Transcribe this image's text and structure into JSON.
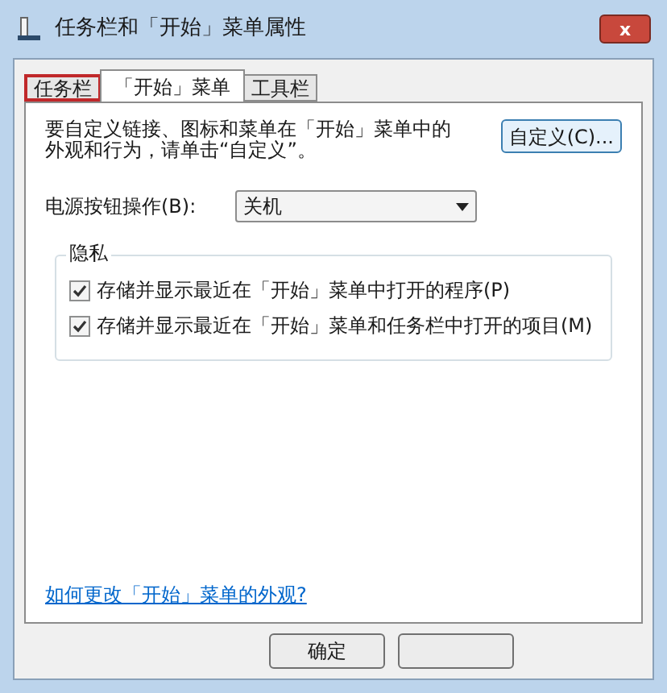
{
  "window": {
    "title": "任务栏和「开始」菜单属性",
    "close": "x"
  },
  "tabs": [
    {
      "label": "任务栏",
      "selected": false,
      "highlighted": true
    },
    {
      "label": "「开始」菜单",
      "selected": true,
      "highlighted": false
    },
    {
      "label": "工具栏",
      "selected": false,
      "highlighted": false
    }
  ],
  "description": "要自定义链接、图标和菜单在「开始」菜单中的外观和行为，请单击“自定义”。",
  "customize_button": "自定义(C)...",
  "power_button": {
    "label": "电源按钮操作(B):",
    "value": "关机"
  },
  "privacy": {
    "title": "隐私",
    "options": [
      {
        "label": "存储并显示最近在「开始」菜单中打开的程序(P)",
        "checked": true
      },
      {
        "label": "存储并显示最近在「开始」菜单和任务栏中打开的项目(M)",
        "checked": true
      }
    ]
  },
  "help_link": "如何更改「开始」菜单的外观?",
  "buttons": [
    {
      "kind": "labeled",
      "label": "确定"
    },
    {
      "kind": "covered"
    }
  ]
}
